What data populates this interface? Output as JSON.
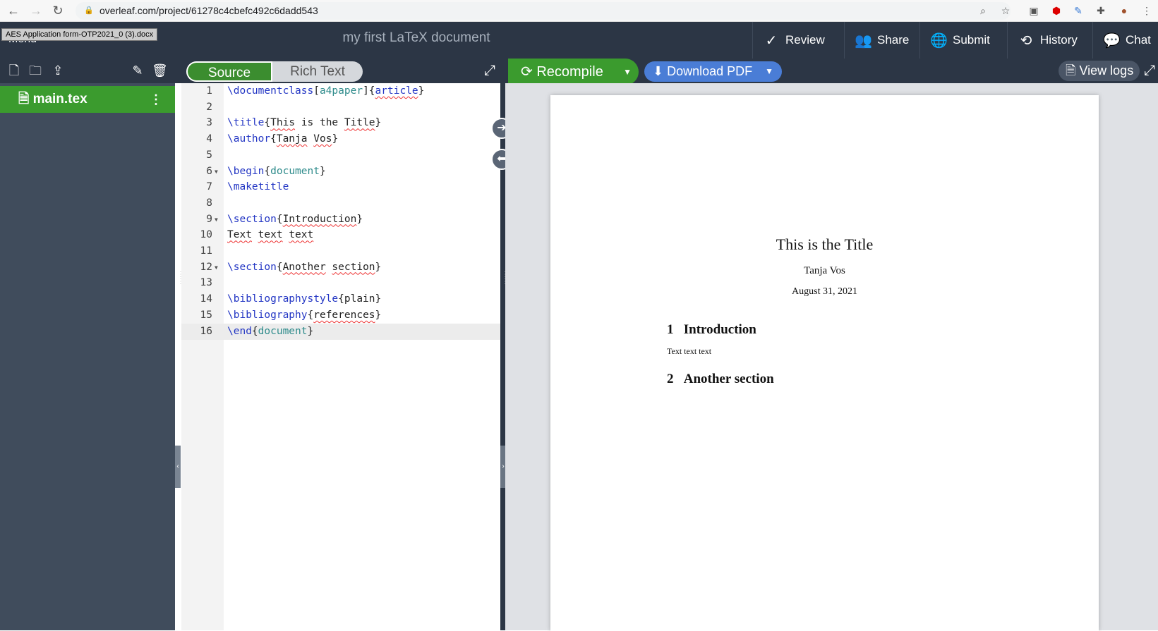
{
  "browser": {
    "url": "overleaf.com/project/61278c4cbefc492c6dadd543"
  },
  "topbar": {
    "tooltip": "AES Application form-OTP2021_0 (3).docx",
    "menu_label": "Menu",
    "project_title": "my first LaTeX document",
    "buttons": {
      "review": "Review",
      "share": "Share",
      "submit": "Submit",
      "history": "History",
      "chat": "Chat"
    }
  },
  "toolbar": {
    "source": "Source",
    "rich_text": "Rich Text",
    "recompile": "Recompile",
    "download_pdf": "Download PDF",
    "view_logs": "View logs"
  },
  "files": [
    {
      "name": "main.tex"
    }
  ],
  "editor": {
    "lines": [
      "\\documentclass[a4paper]{article}",
      "",
      "\\title{This is the Title}",
      "\\author{Tanja Vos}",
      "",
      "\\begin{document}",
      "\\maketitle",
      "",
      "\\section{Introduction}",
      "Text text text",
      "",
      "\\section{Another section}",
      "",
      "\\bibliographystyle{plain}",
      "\\bibliography{references}",
      "\\end{document}"
    ]
  },
  "pdf": {
    "title": "This is the Title",
    "author": "Tanja Vos",
    "date": "August 31, 2021",
    "sections": [
      {
        "num": "1",
        "title": "Introduction",
        "body": "Text text text"
      },
      {
        "num": "2",
        "title": "Another section",
        "body": ""
      }
    ]
  }
}
